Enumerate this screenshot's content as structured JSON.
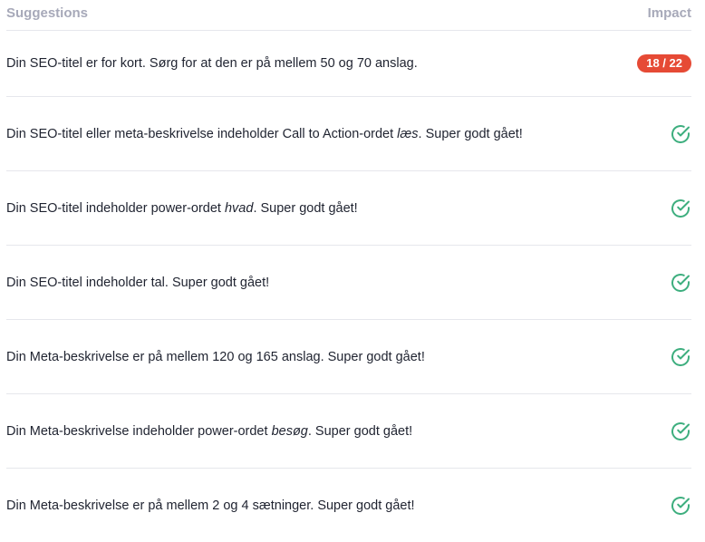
{
  "header": {
    "suggestions_label": "Suggestions",
    "impact_label": "Impact"
  },
  "rows": [
    {
      "pre": "Din SEO-titel er for kort. Sørg for at den er på mellem 50 og 70 anslag.",
      "em": "",
      "post": "",
      "badge": "18 / 22",
      "status": "warning"
    },
    {
      "pre": "Din SEO-titel eller meta-beskrivelse indeholder Call to Action-ordet ",
      "em": "læs",
      "post": ". Super godt gået!",
      "badge": "",
      "status": "ok"
    },
    {
      "pre": "Din SEO-titel indeholder power-ordet ",
      "em": "hvad",
      "post": ". Super godt gået!",
      "badge": "",
      "status": "ok"
    },
    {
      "pre": "Din SEO-titel indeholder tal. Super godt gået!",
      "em": "",
      "post": "",
      "badge": "",
      "status": "ok"
    },
    {
      "pre": "Din Meta-beskrivelse er på mellem 120 og 165 anslag. Super godt gået!",
      "em": "",
      "post": "",
      "badge": "",
      "status": "ok"
    },
    {
      "pre": "Din Meta-beskrivelse indeholder power-ordet ",
      "em": "besøg",
      "post": ". Super godt gået!",
      "badge": "",
      "status": "ok"
    },
    {
      "pre": "Din Meta-beskrivelse er på mellem 2 og 4 sætninger. Super godt gået!",
      "em": "",
      "post": "",
      "badge": "",
      "status": "ok"
    }
  ],
  "colors": {
    "badge": "#e64a35",
    "check": "#3dae7e",
    "header_text": "#a7a9b9",
    "divider": "#e6e7ec"
  },
  "icons": {
    "ok": "check-circle-icon"
  }
}
